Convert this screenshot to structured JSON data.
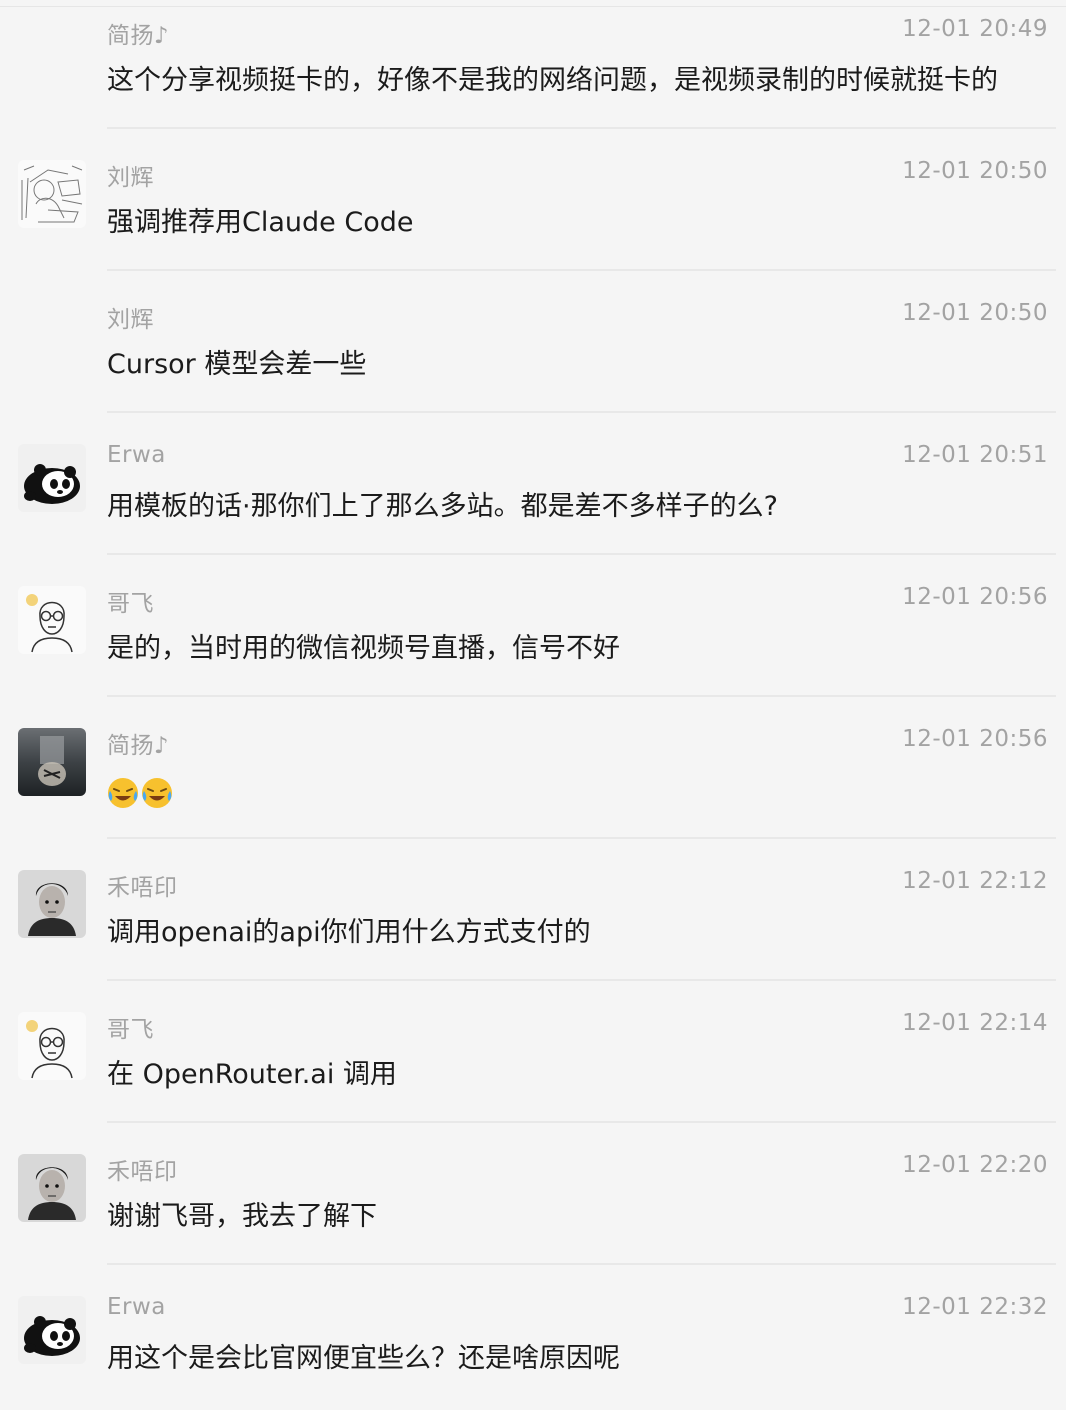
{
  "messages": [
    {
      "sender": "简扬♪",
      "time": "12-01 20:49",
      "text": "这个分享视频挺卡的，好像不是我的网络问题，是视频录制的时候就挺卡的",
      "avatar": "none"
    },
    {
      "sender": "刘辉",
      "time": "12-01 20:50",
      "text": "强调推荐用Claude Code",
      "avatar": "sketch-avatar"
    },
    {
      "sender": "刘辉",
      "time": "12-01 20:50",
      "text": "Cursor 模型会差一些",
      "avatar": "none"
    },
    {
      "sender": "Erwa",
      "time": "12-01 20:51",
      "text": "用模板的话·那你们上了那么多站。都是差不多样子的么?",
      "avatar": "panda-avatar"
    },
    {
      "sender": "哥飞",
      "time": "12-01 20:56",
      "text": "是的，当时用的微信视频号直播，信号不好",
      "avatar": "bald-glasses-avatar"
    },
    {
      "sender": "简扬♪",
      "time": "12-01 20:56",
      "text": "",
      "emoji_count": 2,
      "emoji_name": "laughing-crying-emoji",
      "avatar": "tiger-reflection-avatar"
    },
    {
      "sender": "禾唔印",
      "time": "12-01 22:12",
      "text": "调用openai的api你们用什么方式支付的",
      "avatar": "portrait-avatar"
    },
    {
      "sender": "哥飞",
      "time": "12-01 22:14",
      "text": "在 OpenRouter.ai 调用",
      "avatar": "bald-glasses-avatar"
    },
    {
      "sender": "禾唔印",
      "time": "12-01 22:20",
      "text": "谢谢飞哥，我去了解下",
      "avatar": "portrait-avatar"
    },
    {
      "sender": "Erwa",
      "time": "12-01 22:32",
      "text": "用这个是会比官网便宜些么？还是啥原因呢",
      "avatar": "panda-avatar"
    }
  ]
}
